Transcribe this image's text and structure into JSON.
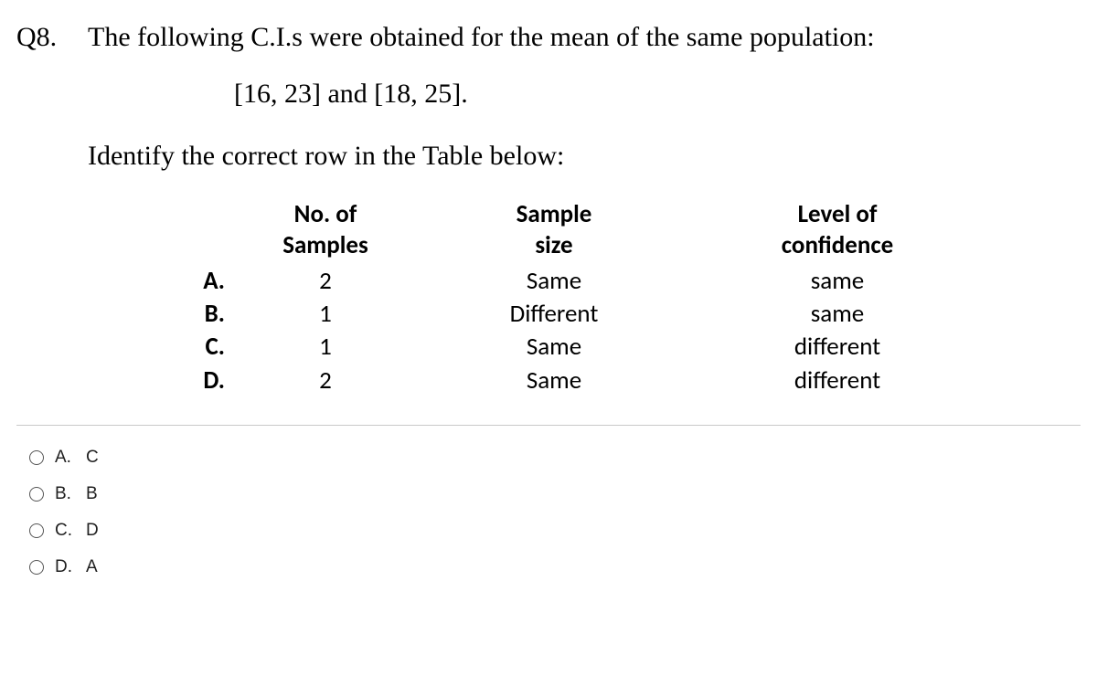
{
  "question": {
    "number": "Q8.",
    "prompt": "The following C.I.s were obtained for the mean of the same population:",
    "intervals": "[16, 23] and [18, 25].",
    "instruction": "Identify the correct row in the Table below:"
  },
  "table": {
    "headers": {
      "samples_l1": "No. of",
      "samples_l2": "Samples",
      "size_l1": "Sample",
      "size_l2": "size",
      "conf_l1": "Level of",
      "conf_l2": "confidence"
    },
    "rows": [
      {
        "label": "A.",
        "samples": "2",
        "size": "Same",
        "conf": "same"
      },
      {
        "label": "B.",
        "samples": "1",
        "size": "Different",
        "conf": "same"
      },
      {
        "label": "C.",
        "samples": "1",
        "size": "Same",
        "conf": "different"
      },
      {
        "label": "D.",
        "samples": "2",
        "size": "Same",
        "conf": "different"
      }
    ]
  },
  "options": [
    {
      "letter": "A.",
      "value": "C"
    },
    {
      "letter": "B.",
      "value": "B"
    },
    {
      "letter": "C.",
      "value": "D"
    },
    {
      "letter": "D.",
      "value": "A"
    }
  ]
}
